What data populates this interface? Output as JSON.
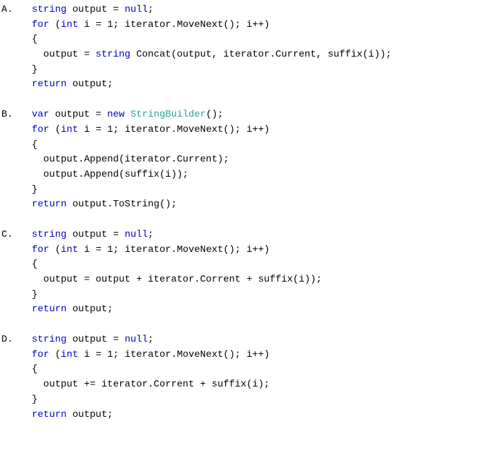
{
  "options": [
    {
      "label": "A.",
      "code": "<span class=\"kw\">string</span> output = <span class=\"kw\">null</span>;\n<span class=\"kw\">for</span> (<span class=\"kw\">int</span> i = 1; iterator.MoveNext(); i++)\n{\n  output = <span class=\"kw\">string</span> Concat(output, iterator.Current, suffix(i));\n}\n<span class=\"kw\">return</span> output;"
    },
    {
      "label": "B.",
      "code": "<span class=\"kw\">var</span> output = <span class=\"kw\">new</span> <span class=\"type\">StringBuilder</span>();\n<span class=\"kw\">for</span> (<span class=\"kw\">int</span> i = 1; iterator.MoveNext(); i++)\n{\n  output.Append(iterator.Current);\n  output.Append(suffix(i));\n}\n<span class=\"kw\">return</span> output.ToString();"
    },
    {
      "label": "C.",
      "code": "<span class=\"kw\">string</span> output = <span class=\"kw\">null</span>;\n<span class=\"kw\">for</span> (<span class=\"kw\">int</span> i = 1; iterator.MoveNext(); i++)\n{\n  output = output + iterator.Corrent + suffix(i));\n}\n<span class=\"kw\">return</span> output;"
    },
    {
      "label": "D.",
      "code": "<span class=\"kw\">string</span> output = <span class=\"kw\">null</span>;\n<span class=\"kw\">for</span> (<span class=\"kw\">int</span> i = 1; iterator.MoveNext(); i++)\n{\n  output += iterator.Corrent + suffix(i);\n}\n<span class=\"kw\">return</span> output;"
    }
  ]
}
